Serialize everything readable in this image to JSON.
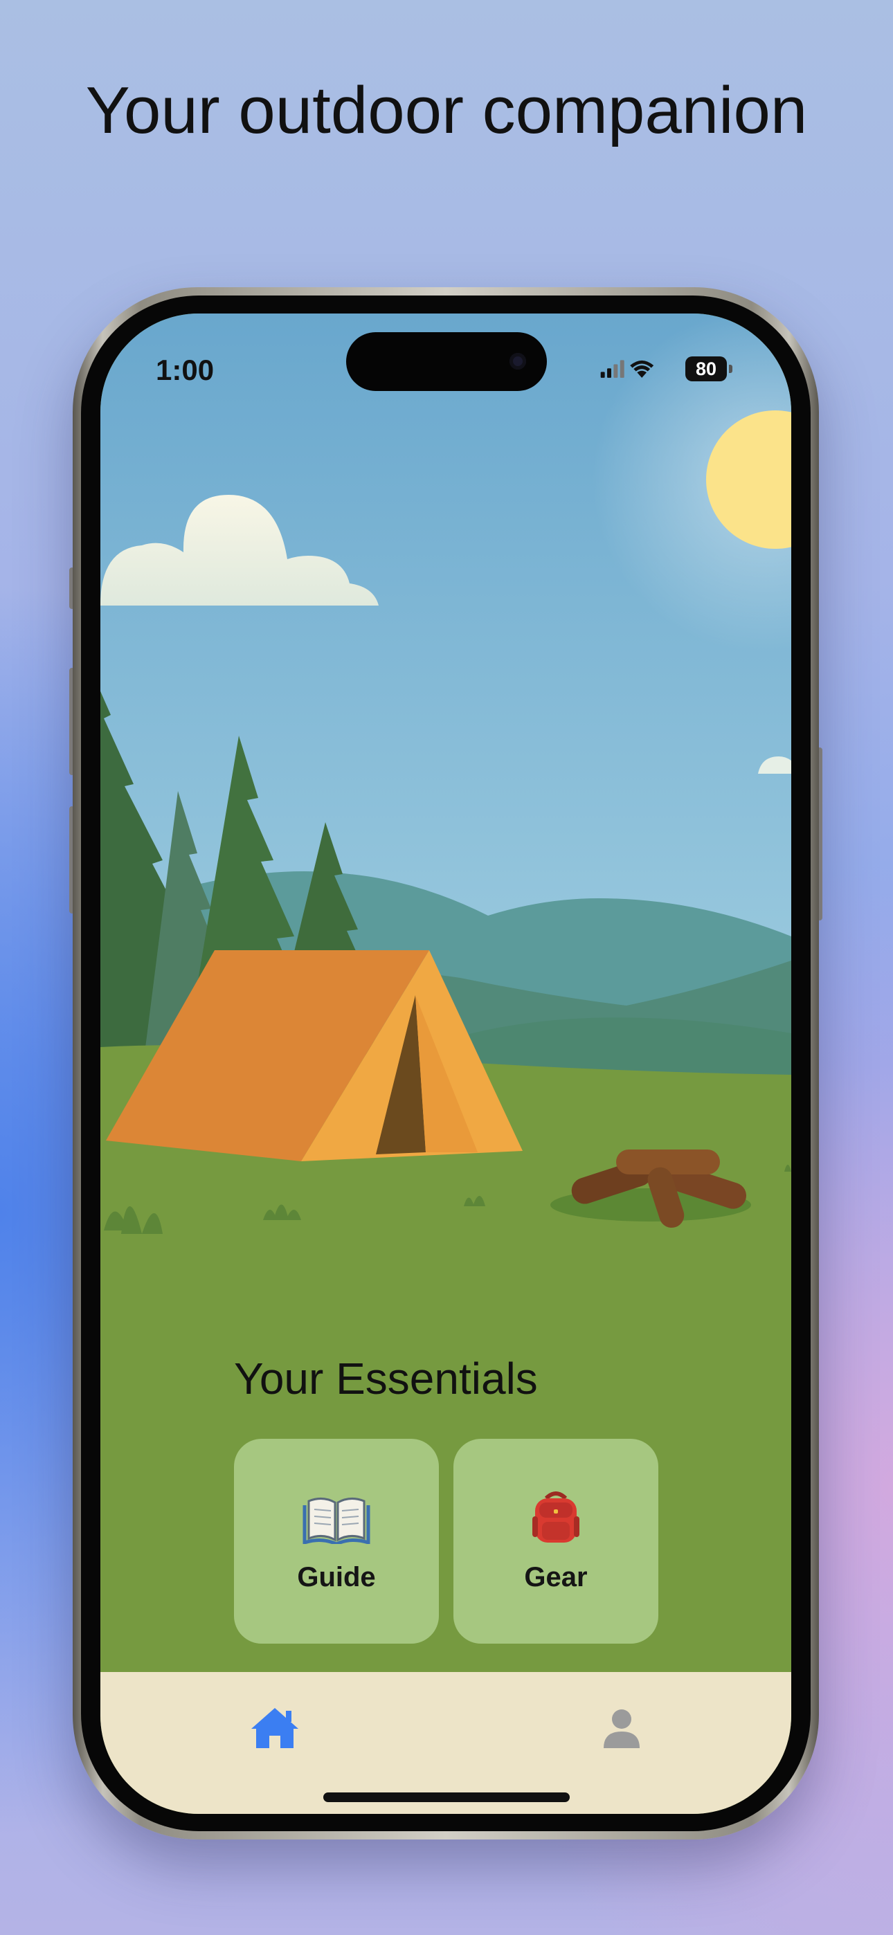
{
  "headline": "Your outdoor companion",
  "status_bar": {
    "time": "1:00",
    "battery": "80",
    "icons": [
      "cellular-signal-icon",
      "wifi-icon",
      "battery-icon"
    ]
  },
  "section": {
    "title": "Your Essentials"
  },
  "cards": [
    {
      "label": "Guide",
      "icon": "open-book-icon"
    },
    {
      "label": "Gear",
      "icon": "backpack-icon"
    }
  ],
  "tab_bar": {
    "items": [
      {
        "icon": "home-icon",
        "active": true,
        "color": "#3b7ef2"
      },
      {
        "icon": "person-icon",
        "active": false,
        "color": "#9b9b9b"
      }
    ]
  },
  "colors": {
    "grass": "#6d9240",
    "card_bg": "#a6c780",
    "tab_bar_bg": "#ede4c8",
    "tent": "#e0883a",
    "sun": "#fbe38a"
  }
}
